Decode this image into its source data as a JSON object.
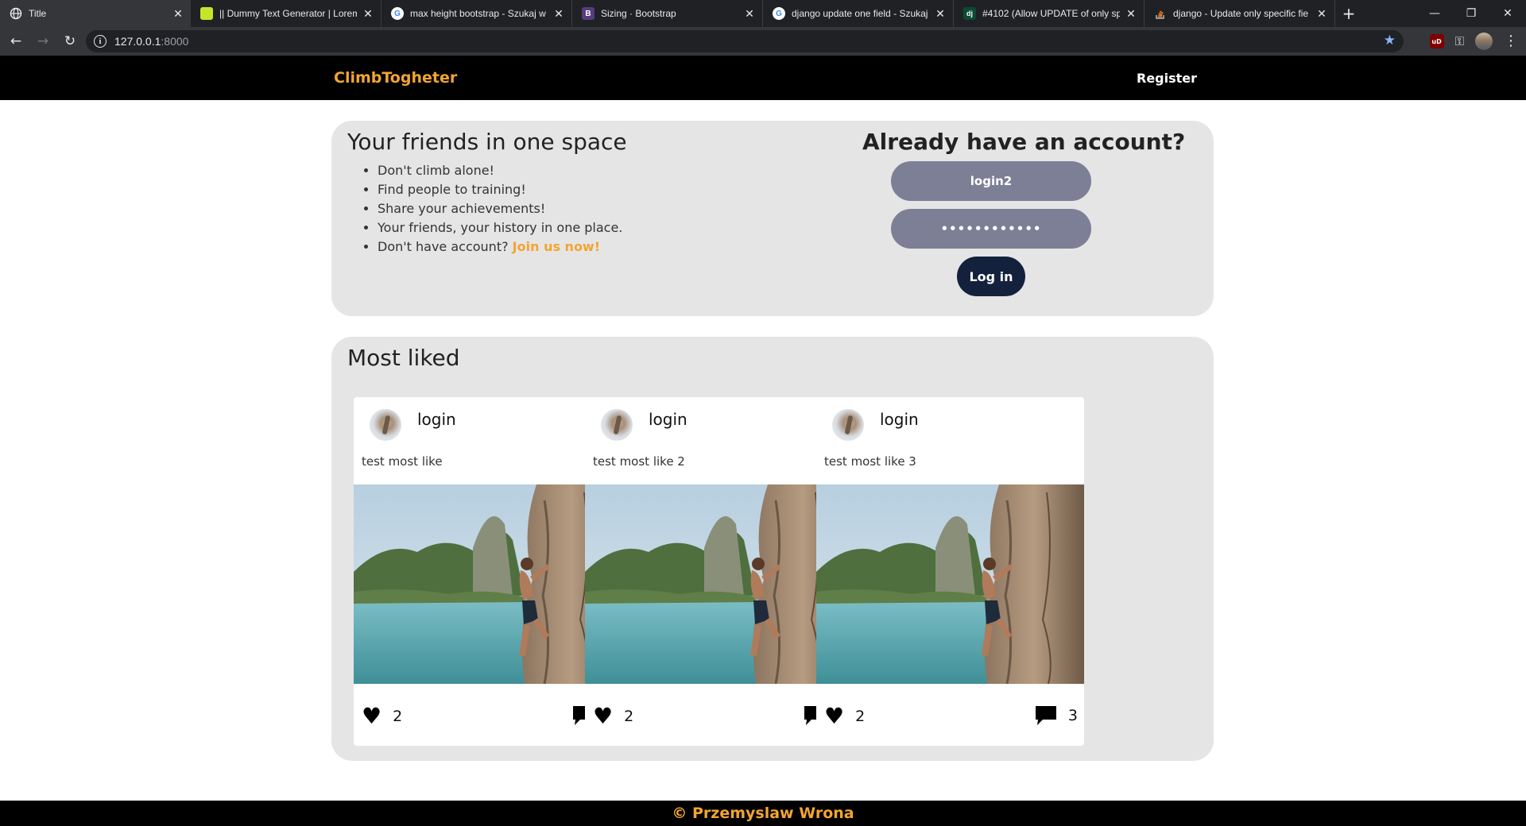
{
  "browser": {
    "tabs": [
      {
        "title": "Title",
        "favicon": "globe-icon",
        "active": true
      },
      {
        "title": "|| Dummy Text Generator | Lorem",
        "favicon": "lorem-favicon-icon",
        "active": false
      },
      {
        "title": "max height bootstrap - Szukaj w",
        "favicon": "google-icon",
        "active": false
      },
      {
        "title": "Sizing · Bootstrap",
        "favicon": "bootstrap-icon",
        "active": false
      },
      {
        "title": "django update one field - Szukaj",
        "favicon": "google-icon",
        "active": false
      },
      {
        "title": "#4102 (Allow UPDATE of only spe",
        "favicon": "django-icon",
        "active": false
      },
      {
        "title": "django - Update only specific fie",
        "favicon": "stackoverflow-icon",
        "active": false
      }
    ],
    "url_host": "127.0.0.1",
    "url_port": ":8000",
    "extension_label": "uD"
  },
  "site": {
    "brand": "ClimbTogheter",
    "nav_register": "Register",
    "intro": {
      "title": "Your friends in one space",
      "points": [
        "Don't climb alone!",
        "Find people to training!",
        "Share your achievements!",
        "Your friends, your history in one place."
      ],
      "last_point_text": "Don't have account? ",
      "join_link": "Join us now!"
    },
    "login": {
      "title": "Already have an account?",
      "username_value": "login2",
      "password_value": "••••••••••••",
      "button": "Log in"
    },
    "most_liked": {
      "title": "Most liked",
      "posts": [
        {
          "author": "login",
          "caption": "test most like",
          "likes": "2",
          "comments": "0"
        },
        {
          "author": "login",
          "caption": "test most like 2",
          "likes": "2",
          "comments": "0"
        },
        {
          "author": "login",
          "caption": "test most like 3",
          "likes": "2",
          "comments": "3"
        }
      ]
    },
    "footer": "© Przemyslaw Wrona"
  },
  "colors": {
    "accent": "#f2a531",
    "navbar": "#000000",
    "panel": "#e5e5e5",
    "input": "#7d7f96",
    "button": "#14213d"
  }
}
